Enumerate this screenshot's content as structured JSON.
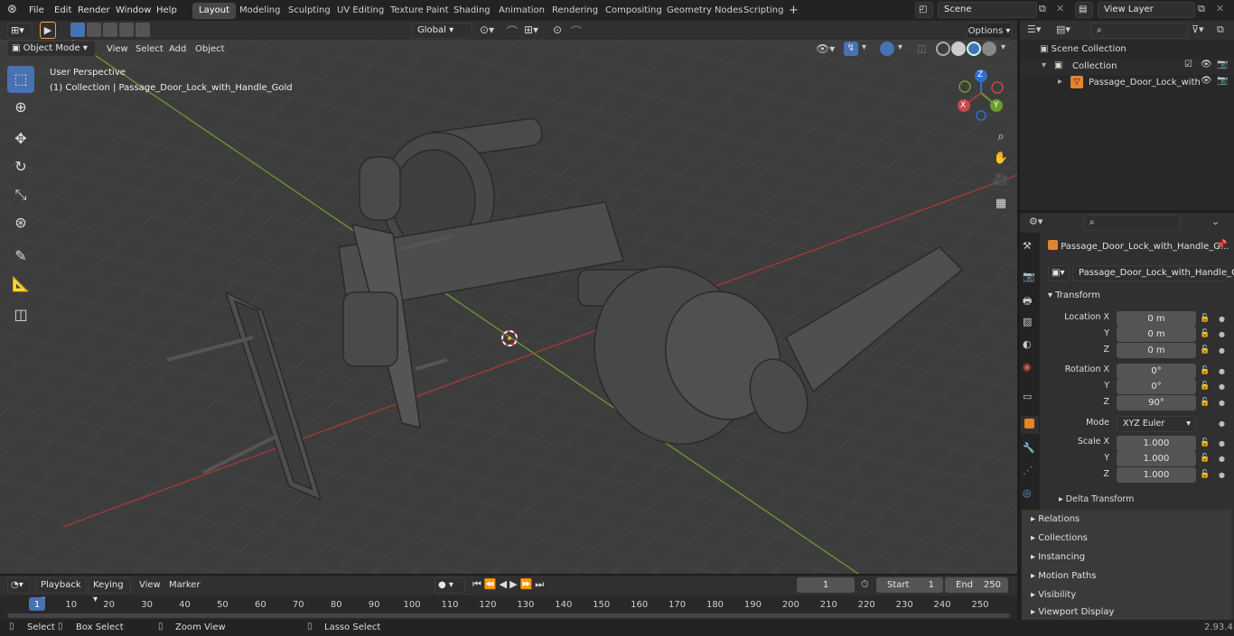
{
  "topbar": {
    "menus": [
      "File",
      "Edit",
      "Render",
      "Window",
      "Help"
    ],
    "workspaces": [
      "Layout",
      "Modeling",
      "Sculpting",
      "UV Editing",
      "Texture Paint",
      "Shading",
      "Animation",
      "Rendering",
      "Compositing",
      "Geometry Nodes",
      "Scripting"
    ],
    "active_workspace": "Layout",
    "add_tab": "+",
    "scene": "Scene",
    "view_layer": "View Layer"
  },
  "header": {
    "mode": "Object Mode",
    "menus": [
      "View",
      "Select",
      "Add",
      "Object"
    ],
    "orientation": "Global",
    "options": "Options"
  },
  "viewport": {
    "view_name": "User Perspective",
    "collection_info": "(1) Collection | Passage_Door_Lock_with_Handle_Gold",
    "gizmo": {
      "x": "X",
      "y": "Y",
      "z": "Z"
    }
  },
  "outliner": {
    "scene_collection": "Scene Collection",
    "collection": "Collection",
    "object": "Passage_Door_Lock_with"
  },
  "properties": {
    "object_name": "Passage_Door_Lock_with_Handle_G...",
    "data_name": "Passage_Door_Lock_with_Handle_Gold",
    "transform_title": "Transform",
    "location": {
      "label": "Location X",
      "x": "0 m",
      "y": "0 m",
      "z": "0 m"
    },
    "rotation": {
      "label": "Rotation X",
      "x": "0°",
      "y": "0°",
      "z": "90°"
    },
    "mode_label": "Mode",
    "mode_value": "XYZ Euler",
    "scale": {
      "label": "Scale X",
      "x": "1.000",
      "y": "1.000",
      "z": "1.000"
    },
    "axis_y": "Y",
    "axis_z": "Z",
    "delta": "Delta Transform",
    "panels": [
      "Relations",
      "Collections",
      "Instancing",
      "Motion Paths",
      "Visibility",
      "Viewport Display"
    ]
  },
  "timeline": {
    "menus": [
      "Playback",
      "Keying",
      "View",
      "Marker"
    ],
    "current_frame": "1",
    "start_label": "Start",
    "start": "1",
    "end_label": "End",
    "end": "250",
    "ticks": [
      "1",
      "10",
      "20",
      "30",
      "40",
      "50",
      "60",
      "70",
      "80",
      "90",
      "100",
      "110",
      "120",
      "130",
      "140",
      "150",
      "160",
      "170",
      "180",
      "190",
      "200",
      "210",
      "220",
      "230",
      "240",
      "250"
    ]
  },
  "statusbar": {
    "select": "Select",
    "box_select": "Box Select",
    "zoom_view": "Zoom View",
    "lasso_select": "Lasso Select",
    "version": "2.93.4"
  },
  "colors": {
    "accent": "#4772b3",
    "x_axis": "#a83a3a",
    "y_axis": "#6e9a2e",
    "z_axis": "#2e6fd0",
    "object_orange": "#e0862f"
  }
}
